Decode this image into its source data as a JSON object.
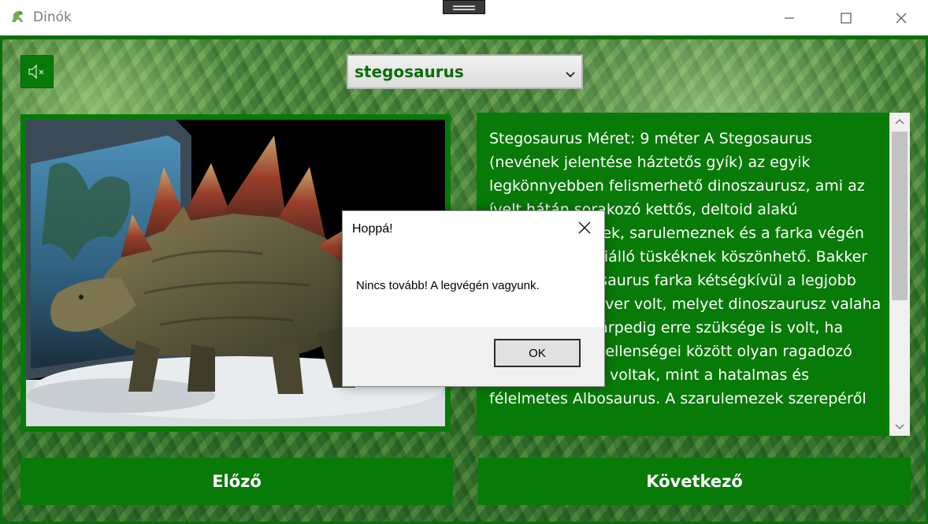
{
  "window": {
    "title": "Dinók",
    "icon": "dino-icon",
    "controls": [
      "minimize-icon",
      "maximize-icon",
      "close-icon"
    ]
  },
  "toolbar": {
    "mute_icon": "speaker-muted-icon",
    "selected_dino": "stegosaurus"
  },
  "image": {
    "subject": "stegosaurus"
  },
  "description": {
    "text": "Stegosaurus Méret: 9 méter A Stegosaurus (nevének jelentése háztetős gyík) az egyik legkönnyebben felismerhető dinoszaurusz, ami az ívelt hátán sorakozó kettős, deltoid alakú csontlemezeknek, sarulemeznek és a farka végén függőlegesen kiálló tüskéknek köszönhető. Bakker így írt: a Stegosaurus farka kétségkívül a legjobb önvédelmi fegyver volt, melyet dinoszaurusz valaha kifejlesztett. Márpedig erre szüksége is volt, ha meggondoljuk, ellenségei között olyan ragadozó dinoszauruszok voltak, mint a hatalmas és félelmetes Albosaurus. A szarulemezek szerepéről"
  },
  "navigation": {
    "prev_label": "Előző",
    "next_label": "Következő"
  },
  "dialog": {
    "title": "Hoppá!",
    "message": "Nincs tovább! A legvégén vagyunk.",
    "ok_label": "OK"
  },
  "colors": {
    "accent_green": "#087a08",
    "dark_green": "#0a6e0a"
  }
}
